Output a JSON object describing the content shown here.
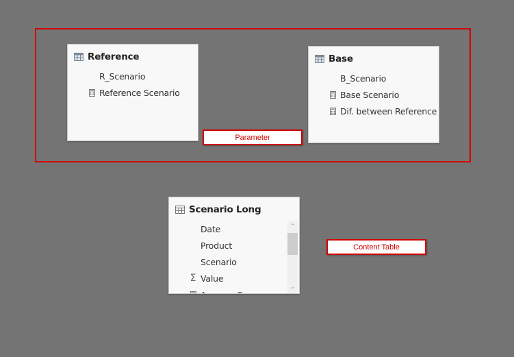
{
  "groups": [
    {
      "label": "Parameter"
    }
  ],
  "annotations": {
    "parameter": "Parameter",
    "content_table": "Content Table"
  },
  "tables": {
    "reference": {
      "title": "Reference",
      "icon": "table-icon",
      "fields": [
        {
          "name": "R_Scenario",
          "icon": "none"
        },
        {
          "name": "Reference Scenario",
          "icon": "calculator-icon"
        }
      ]
    },
    "base": {
      "title": "Base",
      "icon": "table-icon",
      "fields": [
        {
          "name": "B_Scenario",
          "icon": "none"
        },
        {
          "name": "Base Scenario",
          "icon": "calculator-icon"
        },
        {
          "name": "Dif. between Reference",
          "icon": "calculator-icon"
        }
      ]
    },
    "scenario_long": {
      "title": "Scenario Long",
      "icon": "table-icon",
      "fields": [
        {
          "name": "Date",
          "icon": "none"
        },
        {
          "name": "Product",
          "icon": "none"
        },
        {
          "name": "Scenario",
          "icon": "none"
        },
        {
          "name": "Value",
          "icon": "sigma-icon"
        },
        {
          "name": "Average S...",
          "icon": "calculator-icon"
        }
      ],
      "scroll": {
        "up": "⌃",
        "down": "⌄"
      }
    }
  }
}
